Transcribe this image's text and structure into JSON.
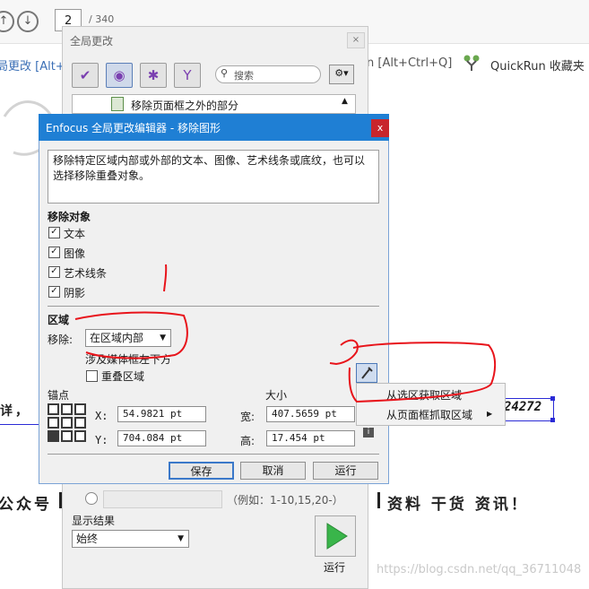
{
  "viewer": {
    "page_current": "2",
    "page_total": "/ 340",
    "left_tool_text": "局更改 [Alt+",
    "shortcut_text": "n [Alt+Ctrl+Q]",
    "quickrun_text": "QuickRun 收藏夹"
  },
  "document": {
    "left_fragment": "详，",
    "code_fragment": "24272",
    "public_text": "公众号",
    "resources_text": "资料  干货  资讯！",
    "watermark": "https://blog.csdn.net/qq_36711048"
  },
  "outer_dialog": {
    "title": "全局更改",
    "search_placeholder": "搜索",
    "list_item": "移除页面框之外的部分",
    "example_text": "（例如：1-10,15,20-）",
    "show_result_label": "显示结果",
    "show_result_value": "始终",
    "run_label": "运行"
  },
  "editor": {
    "title": "Enfocus 全局更改编辑器 - 移除图形",
    "description": "移除特定区域内部或外部的文本、图像、艺术线条或底纹，也可以选择移除重叠对象。",
    "remove_objects_label": "移除对象",
    "checkboxes": [
      {
        "label": "文本",
        "checked": true
      },
      {
        "label": "图像",
        "checked": true
      },
      {
        "label": "艺术线条",
        "checked": true
      },
      {
        "label": "阴影",
        "checked": true
      }
    ],
    "region_label": "区域",
    "remove_label": "移除:",
    "remove_value": "在区域内部",
    "media_box_text": "涉及媒体框左下方",
    "overlap_label": "重叠区域",
    "anchor_label": "锚点",
    "size_label": "大小",
    "x_label": "X:",
    "x_value": "54.9821 pt",
    "y_label": "Y:",
    "y_value": "704.084 pt",
    "width_label": "宽:",
    "width_value": "407.5659 pt",
    "height_label": "高:",
    "height_value": "17.454 pt",
    "save_label": "保存",
    "cancel_label": "取消",
    "run_label": "运行"
  },
  "context_menu": {
    "items": [
      "从选区获取区域",
      "从页面框抓取区域"
    ]
  },
  "colors": {
    "title_bar": "#1f7fd4",
    "close_button": "#c8252c",
    "annotation_red": "#e8141b",
    "play_green": "#39b54a"
  }
}
